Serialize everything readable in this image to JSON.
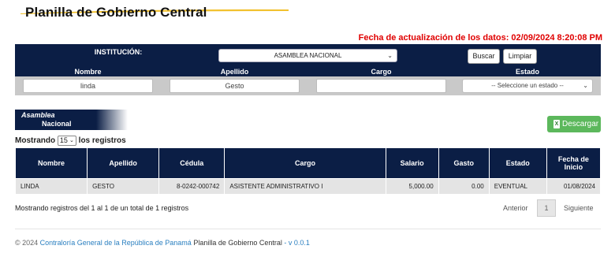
{
  "header": {
    "title": "Planilla de Gobierno Central"
  },
  "update": {
    "text": "Fecha de actualización de los datos: 02/09/2024 8:20:08 PM"
  },
  "filters": {
    "institucion_label": "INSTITUCIÓN:",
    "institucion_value": "ASAMBLEA NACIONAL",
    "buscar": "Buscar",
    "limpiar": "Limpiar",
    "nombre_label": "Nombre",
    "apellido_label": "Apellido",
    "cargo_label": "Cargo",
    "estado_label": "Estado",
    "nombre_value": "linda",
    "apellido_value": "Gesto",
    "cargo_value": "",
    "estado_value": "-- Seleccione un estado --"
  },
  "institution_badge": {
    "line1": "Asamblea",
    "line2": "Nacional"
  },
  "download": {
    "label": "Descargar"
  },
  "listing": {
    "prefix": "Mostrando",
    "page_size": "15",
    "suffix": "los registros"
  },
  "table": {
    "headers": [
      "Nombre",
      "Apellido",
      "Cédula",
      "Cargo",
      "Salario",
      "Gasto",
      "Estado",
      "Fecha de Inicio"
    ],
    "rows": [
      [
        "LINDA",
        "GESTO",
        "8-0242-000742",
        "ASISTENTE ADMINISTRATIVO I",
        "5,000.00",
        "0.00",
        "EVENTUAL",
        "01/08/2024"
      ]
    ]
  },
  "pagination": {
    "info": "Mostrando registros del 1 al 1 de un total de 1 registros",
    "prev": "Anterior",
    "current": "1",
    "next": "Siguiente"
  },
  "footer": {
    "copy": "© 2024",
    "org": "Contraloría General de la República de Panamá",
    "app": "Planilla de Gobierno Central",
    "version": "- v 0.0.1"
  },
  "colors": {
    "navy": "#0b1e45",
    "red": "#e00000",
    "green": "#5cb85c",
    "link": "#2a7fc0",
    "swoosh": "#f2c12e"
  }
}
